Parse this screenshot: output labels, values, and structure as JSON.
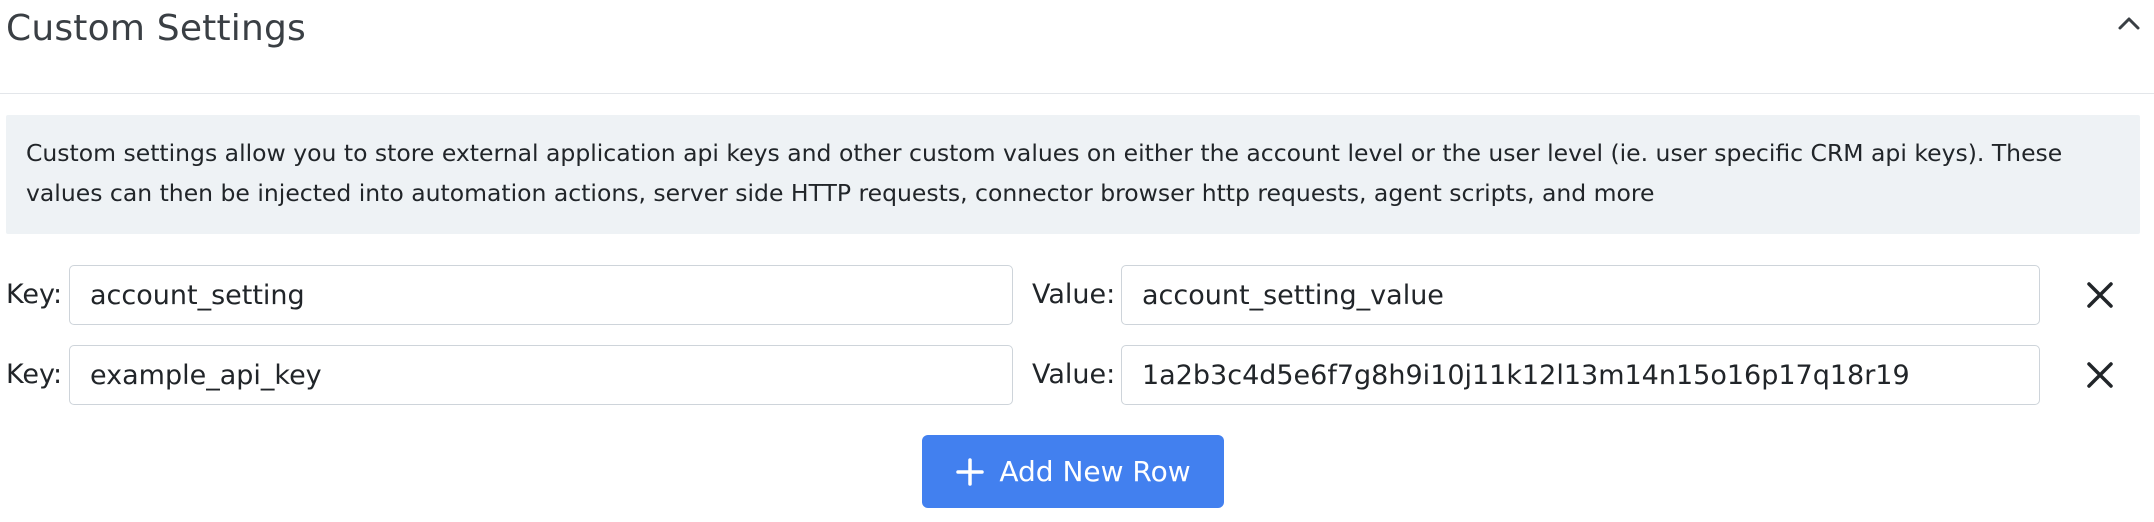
{
  "header": {
    "title": "Custom Settings",
    "collapse_icon": "chevron-up-icon"
  },
  "info": {
    "text": "Custom settings allow you to store external application api keys and other custom values on either the account level or the user level (ie. user specific CRM api keys). These values can then be injected into automation actions, server side HTTP requests, connector browser http requests, agent scripts, and more"
  },
  "rows": [
    {
      "key_label": "Key:",
      "key_value": "account_setting",
      "value_label": "Value:",
      "value_value": "account_setting_value",
      "remove_icon": "close-icon"
    },
    {
      "key_label": "Key:",
      "key_value": "example_api_key",
      "value_label": "Value:",
      "value_value": "1a2b3c4d5e6f7g8h9i10j11k12l13m14n15o16p17q18r19",
      "remove_icon": "close-icon"
    }
  ],
  "add_button": {
    "label": "Add New Row",
    "icon": "plus-icon"
  },
  "colors": {
    "accent": "#4280ef",
    "info_bg": "#eef2f5",
    "border": "#ced4da",
    "text": "#212529"
  }
}
